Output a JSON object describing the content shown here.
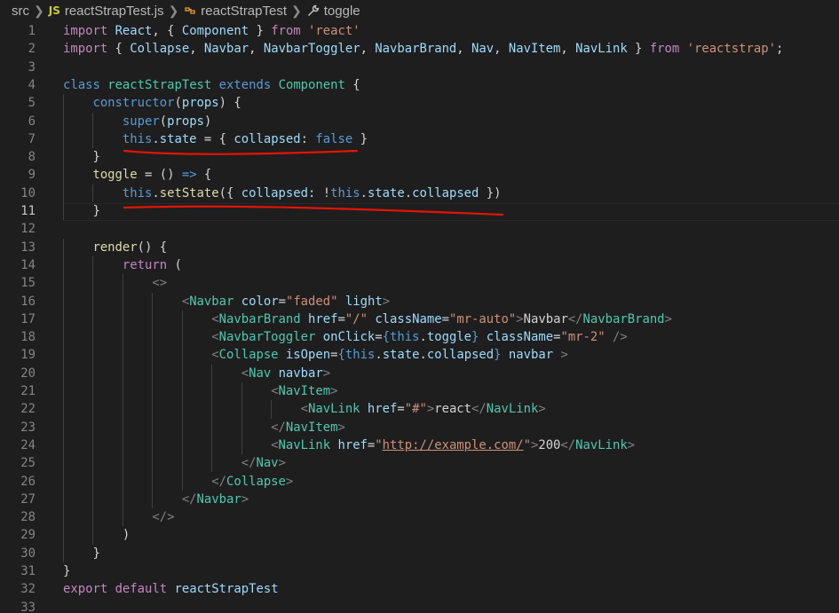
{
  "breadcrumb": {
    "folder": "src",
    "file": "reactStrapTest.js",
    "file_icon": "JS",
    "class_name": "reactStrapTest",
    "member": "toggle"
  },
  "editor": {
    "active_line": 11,
    "lines": [
      {
        "n": "1",
        "t": [
          [
            "imp",
            "import"
          ],
          [
            "pun",
            " "
          ],
          [
            "var",
            "React"
          ],
          [
            "pun",
            ", { "
          ],
          [
            "var",
            "Component"
          ],
          [
            "pun",
            " } "
          ],
          [
            "imp",
            "from"
          ],
          [
            "pun",
            " "
          ],
          [
            "str",
            "'react'"
          ]
        ]
      },
      {
        "n": "2",
        "t": [
          [
            "imp",
            "import"
          ],
          [
            "pun",
            " { "
          ],
          [
            "var",
            "Collapse"
          ],
          [
            "pun",
            ", "
          ],
          [
            "var",
            "Navbar"
          ],
          [
            "pun",
            ", "
          ],
          [
            "var",
            "NavbarToggler"
          ],
          [
            "pun",
            ", "
          ],
          [
            "var",
            "NavbarBrand"
          ],
          [
            "pun",
            ", "
          ],
          [
            "var",
            "Nav"
          ],
          [
            "pun",
            ", "
          ],
          [
            "var",
            "NavItem"
          ],
          [
            "pun",
            ", "
          ],
          [
            "var",
            "NavLink"
          ],
          [
            "pun",
            " } "
          ],
          [
            "imp",
            "from"
          ],
          [
            "pun",
            " "
          ],
          [
            "str",
            "'reactstrap'"
          ],
          [
            "pun",
            ";"
          ]
        ]
      },
      {
        "n": "3",
        "t": []
      },
      {
        "n": "4",
        "t": [
          [
            "kw",
            "class"
          ],
          [
            "pun",
            " "
          ],
          [
            "cls",
            "reactStrapTest"
          ],
          [
            "pun",
            " "
          ],
          [
            "kw",
            "extends"
          ],
          [
            "pun",
            " "
          ],
          [
            "cls",
            "Component"
          ],
          [
            "pun",
            " {"
          ]
        ]
      },
      {
        "n": "5",
        "t": [
          [
            "pun",
            "    "
          ],
          [
            "kw",
            "constructor"
          ],
          [
            "pun",
            "("
          ],
          [
            "var",
            "props"
          ],
          [
            "pun",
            ") {"
          ]
        ]
      },
      {
        "n": "6",
        "t": [
          [
            "pun",
            "        "
          ],
          [
            "kw",
            "super"
          ],
          [
            "pun",
            "("
          ],
          [
            "var",
            "props"
          ],
          [
            "pun",
            ")"
          ]
        ]
      },
      {
        "n": "7",
        "t": [
          [
            "pun",
            "        "
          ],
          [
            "kw",
            "this"
          ],
          [
            "pun",
            "."
          ],
          [
            "var",
            "state"
          ],
          [
            "pun",
            " = { "
          ],
          [
            "var",
            "collapsed"
          ],
          [
            "pun",
            ": "
          ],
          [
            "kw",
            "false"
          ],
          [
            "pun",
            " }"
          ]
        ]
      },
      {
        "n": "8",
        "t": [
          [
            "pun",
            "    }"
          ]
        ]
      },
      {
        "n": "9",
        "t": [
          [
            "pun",
            "    "
          ],
          [
            "fn",
            "toggle"
          ],
          [
            "pun",
            " = () "
          ],
          [
            "kw",
            "=>"
          ],
          [
            "pun",
            " {"
          ]
        ]
      },
      {
        "n": "10",
        "t": [
          [
            "pun",
            "        "
          ],
          [
            "kw",
            "this"
          ],
          [
            "pun",
            "."
          ],
          [
            "fn",
            "setState"
          ],
          [
            "pun",
            "({ "
          ],
          [
            "var",
            "collapsed"
          ],
          [
            "pun",
            ": !"
          ],
          [
            "kw",
            "this"
          ],
          [
            "pun",
            "."
          ],
          [
            "var",
            "state"
          ],
          [
            "pun",
            "."
          ],
          [
            "var",
            "collapsed"
          ],
          [
            "pun",
            " })"
          ]
        ]
      },
      {
        "n": "11",
        "t": [
          [
            "pun",
            "    }"
          ]
        ]
      },
      {
        "n": "12",
        "t": []
      },
      {
        "n": "13",
        "t": [
          [
            "pun",
            "    "
          ],
          [
            "fn",
            "render"
          ],
          [
            "pun",
            "() {"
          ]
        ]
      },
      {
        "n": "14",
        "t": [
          [
            "pun",
            "        "
          ],
          [
            "imp",
            "return"
          ],
          [
            "pun",
            " ("
          ]
        ]
      },
      {
        "n": "15",
        "t": [
          [
            "pun",
            "            "
          ],
          [
            "br",
            "<>"
          ]
        ]
      },
      {
        "n": "16",
        "t": [
          [
            "pun",
            "                "
          ],
          [
            "br",
            "<"
          ],
          [
            "tag",
            "Navbar"
          ],
          [
            "pun",
            " "
          ],
          [
            "var",
            "color"
          ],
          [
            "pun",
            "="
          ],
          [
            "str",
            "\"faded\""
          ],
          [
            "pun",
            " "
          ],
          [
            "var",
            "light"
          ],
          [
            "br",
            ">"
          ]
        ]
      },
      {
        "n": "17",
        "t": [
          [
            "pun",
            "                    "
          ],
          [
            "br",
            "<"
          ],
          [
            "tag",
            "NavbarBrand"
          ],
          [
            "pun",
            " "
          ],
          [
            "var",
            "href"
          ],
          [
            "pun",
            "="
          ],
          [
            "str",
            "\"/\""
          ],
          [
            "pun",
            " "
          ],
          [
            "var",
            "className"
          ],
          [
            "pun",
            "="
          ],
          [
            "str",
            "\"mr-auto\""
          ],
          [
            "br",
            ">"
          ],
          [
            "pun",
            "Navbar"
          ],
          [
            "br",
            "</"
          ],
          [
            "tag",
            "NavbarBrand"
          ],
          [
            "br",
            ">"
          ]
        ]
      },
      {
        "n": "18",
        "t": [
          [
            "pun",
            "                    "
          ],
          [
            "br",
            "<"
          ],
          [
            "tag",
            "NavbarToggler"
          ],
          [
            "pun",
            " "
          ],
          [
            "var",
            "onClick"
          ],
          [
            "pun",
            "="
          ],
          [
            "kw",
            "{"
          ],
          [
            "kw",
            "this"
          ],
          [
            "pun",
            "."
          ],
          [
            "var",
            "toggle"
          ],
          [
            "kw",
            "}"
          ],
          [
            "pun",
            " "
          ],
          [
            "var",
            "className"
          ],
          [
            "pun",
            "="
          ],
          [
            "str",
            "\"mr-2\""
          ],
          [
            "pun",
            " "
          ],
          [
            "br",
            "/>"
          ]
        ]
      },
      {
        "n": "19",
        "t": [
          [
            "pun",
            "                    "
          ],
          [
            "br",
            "<"
          ],
          [
            "tag",
            "Collapse"
          ],
          [
            "pun",
            " "
          ],
          [
            "var",
            "isOpen"
          ],
          [
            "pun",
            "="
          ],
          [
            "kw",
            "{"
          ],
          [
            "kw",
            "this"
          ],
          [
            "pun",
            "."
          ],
          [
            "var",
            "state"
          ],
          [
            "pun",
            "."
          ],
          [
            "var",
            "collapsed"
          ],
          [
            "kw",
            "}"
          ],
          [
            "pun",
            " "
          ],
          [
            "var",
            "navbar"
          ],
          [
            "pun",
            " "
          ],
          [
            "br",
            ">"
          ]
        ]
      },
      {
        "n": "20",
        "t": [
          [
            "pun",
            "                        "
          ],
          [
            "br",
            "<"
          ],
          [
            "tag",
            "Nav"
          ],
          [
            "pun",
            " "
          ],
          [
            "var",
            "navbar"
          ],
          [
            "br",
            ">"
          ]
        ]
      },
      {
        "n": "21",
        "t": [
          [
            "pun",
            "                            "
          ],
          [
            "br",
            "<"
          ],
          [
            "tag",
            "NavItem"
          ],
          [
            "br",
            ">"
          ]
        ]
      },
      {
        "n": "22",
        "t": [
          [
            "pun",
            "                                "
          ],
          [
            "br",
            "<"
          ],
          [
            "tag",
            "NavLink"
          ],
          [
            "pun",
            " "
          ],
          [
            "var",
            "href"
          ],
          [
            "pun",
            "="
          ],
          [
            "str",
            "\"#\""
          ],
          [
            "br",
            ">"
          ],
          [
            "pun",
            "react"
          ],
          [
            "br",
            "</"
          ],
          [
            "tag",
            "NavLink"
          ],
          [
            "br",
            ">"
          ]
        ]
      },
      {
        "n": "23",
        "t": [
          [
            "pun",
            "                            "
          ],
          [
            "br",
            "</"
          ],
          [
            "tag",
            "NavItem"
          ],
          [
            "br",
            ">"
          ]
        ]
      },
      {
        "n": "24",
        "t": [
          [
            "pun",
            "                            "
          ],
          [
            "br",
            "<"
          ],
          [
            "tag",
            "NavLink"
          ],
          [
            "pun",
            " "
          ],
          [
            "var",
            "href"
          ],
          [
            "pun",
            "="
          ],
          [
            "str",
            "\""
          ],
          [
            "link",
            "http://example.com/"
          ],
          [
            "str",
            "\""
          ],
          [
            "br",
            ">"
          ],
          [
            "pun",
            "200"
          ],
          [
            "br",
            "</"
          ],
          [
            "tag",
            "NavLink"
          ],
          [
            "br",
            ">"
          ]
        ]
      },
      {
        "n": "25",
        "t": [
          [
            "pun",
            "                        "
          ],
          [
            "br",
            "</"
          ],
          [
            "tag",
            "Nav"
          ],
          [
            "br",
            ">"
          ]
        ]
      },
      {
        "n": "26",
        "t": [
          [
            "pun",
            "                    "
          ],
          [
            "br",
            "</"
          ],
          [
            "tag",
            "Collapse"
          ],
          [
            "br",
            ">"
          ]
        ]
      },
      {
        "n": "27",
        "t": [
          [
            "pun",
            "                "
          ],
          [
            "br",
            "</"
          ],
          [
            "tag",
            "Navbar"
          ],
          [
            "br",
            ">"
          ]
        ]
      },
      {
        "n": "28",
        "t": [
          [
            "pun",
            "            "
          ],
          [
            "br",
            "</>"
          ]
        ]
      },
      {
        "n": "29",
        "t": [
          [
            "pun",
            "        )"
          ]
        ]
      },
      {
        "n": "30",
        "t": [
          [
            "pun",
            "    }"
          ]
        ]
      },
      {
        "n": "31",
        "t": [
          [
            "pun",
            "}"
          ]
        ]
      },
      {
        "n": "32",
        "t": [
          [
            "imp",
            "export"
          ],
          [
            "pun",
            " "
          ],
          [
            "imp",
            "default"
          ],
          [
            "pun",
            " "
          ],
          [
            "var",
            "reactStrapTest"
          ]
        ]
      },
      {
        "n": "33",
        "t": []
      }
    ]
  },
  "colors": {
    "background": "#1e1e1e",
    "annotation_underline": "#e51400"
  }
}
